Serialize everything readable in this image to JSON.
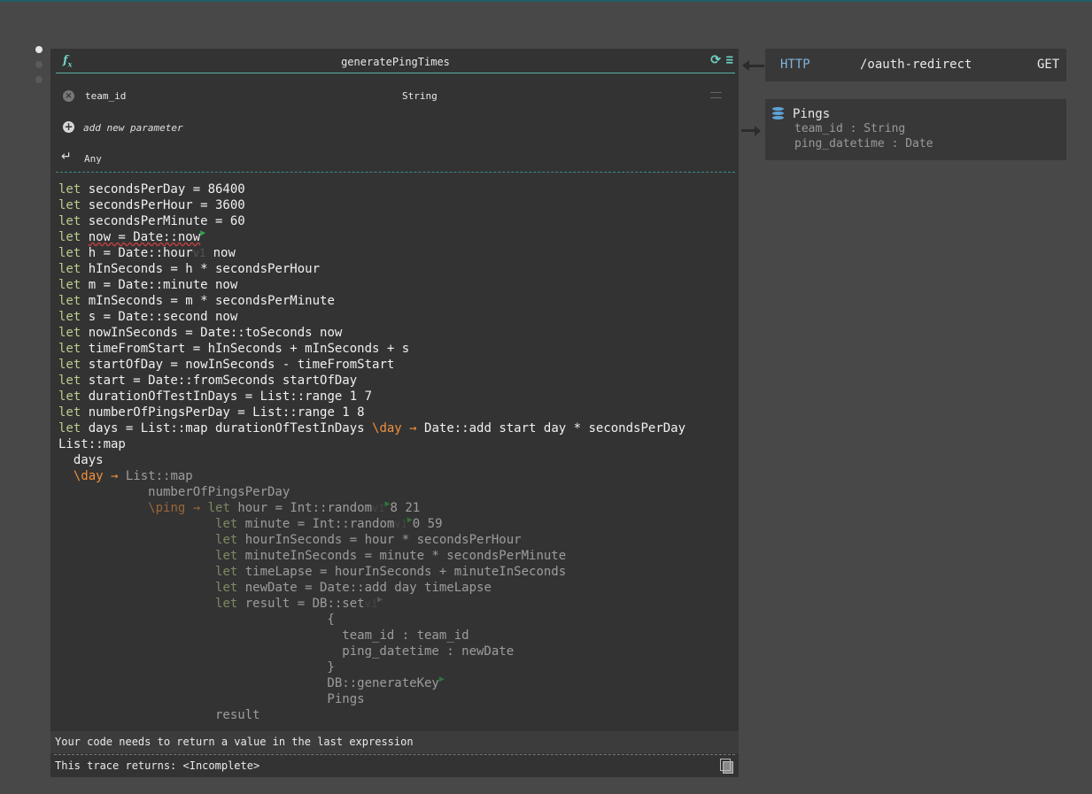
{
  "function": {
    "name": "generatePingTimes",
    "param": {
      "name": "team_id",
      "type": "String"
    },
    "add_param_label": "add new parameter",
    "return_type": "Any"
  },
  "code_lines": [
    [
      "let ",
      "secondsPerDay = 86400"
    ],
    [
      "let ",
      "secondsPerHour = 3600"
    ],
    [
      "let ",
      "secondsPerMinute = 60"
    ]
  ],
  "messages": {
    "error": "Your code needs to return a value in the last expression",
    "trace": "This trace returns: <Incomplete>"
  },
  "http_handler": {
    "label": "HTTP",
    "path": "/oauth-redirect",
    "verb": "GET"
  },
  "database": {
    "name": "Pings",
    "fields": [
      "team_id : String",
      "ping_datetime : Date"
    ]
  },
  "colors": {
    "accent": "#6fd1c4",
    "keyword": "#b9ce8c",
    "lambda": "#f0903e",
    "http": "#7fb4dd",
    "db_icon": "#5fa3d6"
  }
}
